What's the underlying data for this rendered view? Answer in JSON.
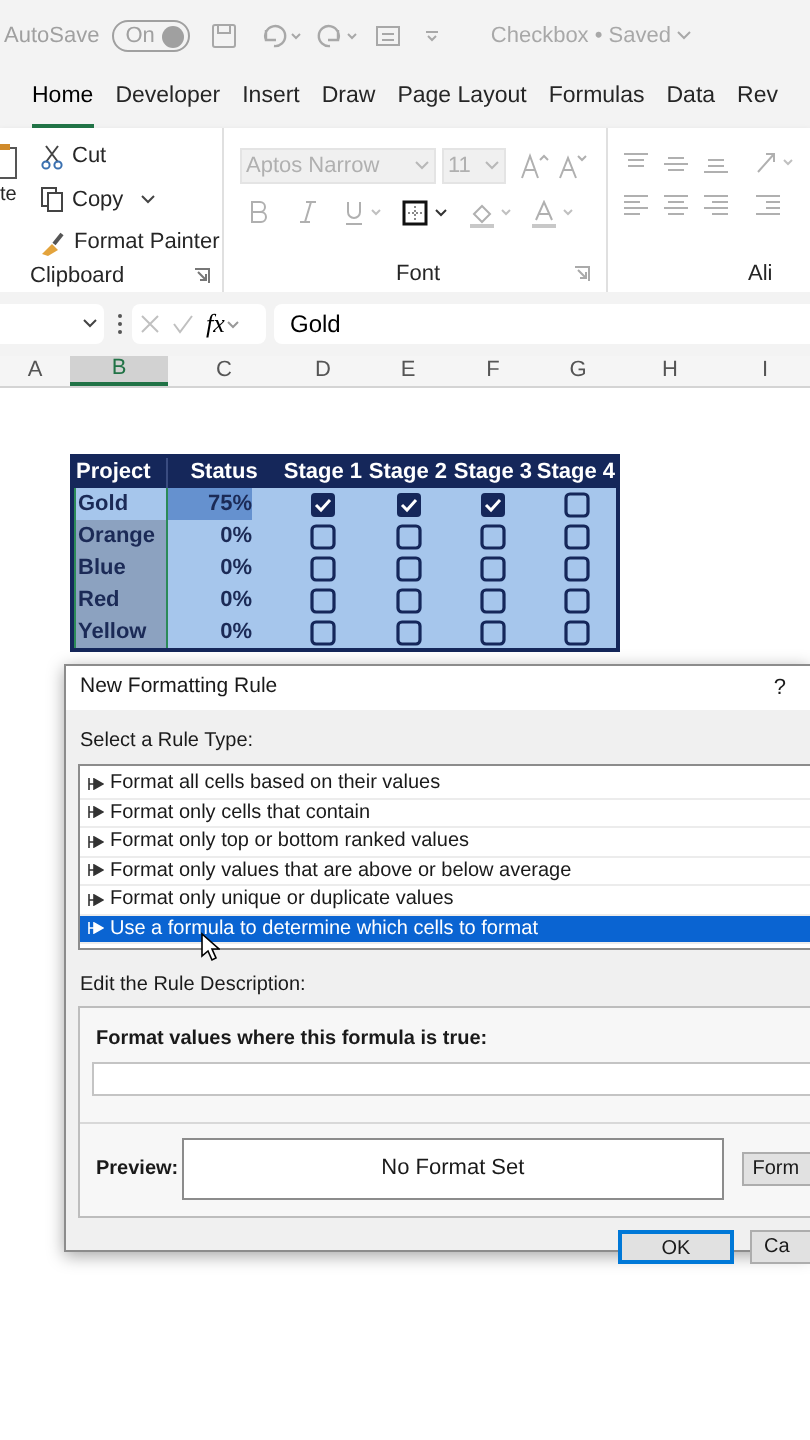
{
  "title_bar": {
    "autosave_label": "AutoSave",
    "autosave": {
      "label": "On",
      "on": true
    },
    "document": "Checkbox • Saved"
  },
  "tabs": [
    {
      "label": "Home",
      "selected": true
    },
    {
      "label": "Developer",
      "selected": false
    },
    {
      "label": "Insert",
      "selected": false
    },
    {
      "label": "Draw",
      "selected": false
    },
    {
      "label": "Page Layout",
      "selected": false
    },
    {
      "label": "Formulas",
      "selected": false
    },
    {
      "label": "Data",
      "selected": false
    },
    {
      "label": "Rev",
      "selected": false
    }
  ],
  "ribbon": {
    "clipboard": {
      "paste_label": "te",
      "cut": "Cut",
      "copy": "Copy",
      "format_painter": "Format Painter",
      "group_label": "Clipboard"
    },
    "font": {
      "font_name": "Aptos Narrow",
      "font_size": "11",
      "group_label": "Font"
    },
    "alignment": {
      "group_label": "Ali"
    }
  },
  "formula_bar": {
    "function_label": "fx",
    "formula": "Gold"
  },
  "columns": [
    {
      "label": "A",
      "selected": false
    },
    {
      "label": "B",
      "selected": true
    },
    {
      "label": "C",
      "selected": false
    },
    {
      "label": "D",
      "selected": false
    },
    {
      "label": "E",
      "selected": false
    },
    {
      "label": "F",
      "selected": false
    },
    {
      "label": "G",
      "selected": false
    },
    {
      "label": "H",
      "selected": false
    },
    {
      "label": "I",
      "selected": false
    }
  ],
  "table": {
    "columns": [
      "Project",
      "Status",
      "Stage 1",
      "Stage 2",
      "Stage 3",
      "Stage 4"
    ],
    "rows": [
      {
        "project": "Gold",
        "active": true,
        "status": "75%",
        "level": 0.75,
        "stages": [
          {
            "checked": true
          },
          {
            "checked": true
          },
          {
            "checked": true
          },
          {
            "checked": false
          }
        ]
      },
      {
        "project": "Orange",
        "active": false,
        "status": "0%",
        "stages": [
          {
            "checked": false
          },
          {
            "checked": false
          },
          {
            "checked": false
          },
          {
            "checked": false
          }
        ]
      },
      {
        "project": "Blue",
        "active": false,
        "status": "0%",
        "stages": [
          {
            "checked": false
          },
          {
            "checked": false
          },
          {
            "checked": false
          },
          {
            "checked": false
          }
        ]
      },
      {
        "project": "Red",
        "active": false,
        "status": "0%",
        "stages": [
          {
            "checked": false
          },
          {
            "checked": false
          },
          {
            "checked": false
          },
          {
            "checked": false
          }
        ]
      },
      {
        "project": "Yellow",
        "active": false,
        "status": "0%",
        "stages": [
          {
            "checked": false
          },
          {
            "checked": false
          },
          {
            "checked": false
          },
          {
            "checked": false
          }
        ]
      }
    ]
  },
  "dialog": {
    "title": "New Formatting Rule",
    "help": "?",
    "rule_type_label": "Select a Rule Type:",
    "rule_types": [
      {
        "label": "Format all cells based on their values",
        "selected": false
      },
      {
        "label": "Format only cells that contain",
        "selected": false
      },
      {
        "label": "Format only top or bottom ranked values",
        "selected": false
      },
      {
        "label": "Format only values that are above or below average",
        "selected": false
      },
      {
        "label": "Format only unique or duplicate values",
        "selected": false
      },
      {
        "label": "Use a formula to determine which cells to format",
        "selected": true
      }
    ],
    "description_label": "Edit the Rule Description:",
    "formula_label": "Format values where this formula is true:",
    "preview_label": "Preview:",
    "preview_text": "No Format Set",
    "format_button": "Form",
    "buttons": [
      {
        "label": "OK",
        "default": true
      },
      {
        "label": "Ca",
        "default": false
      }
    ]
  }
}
